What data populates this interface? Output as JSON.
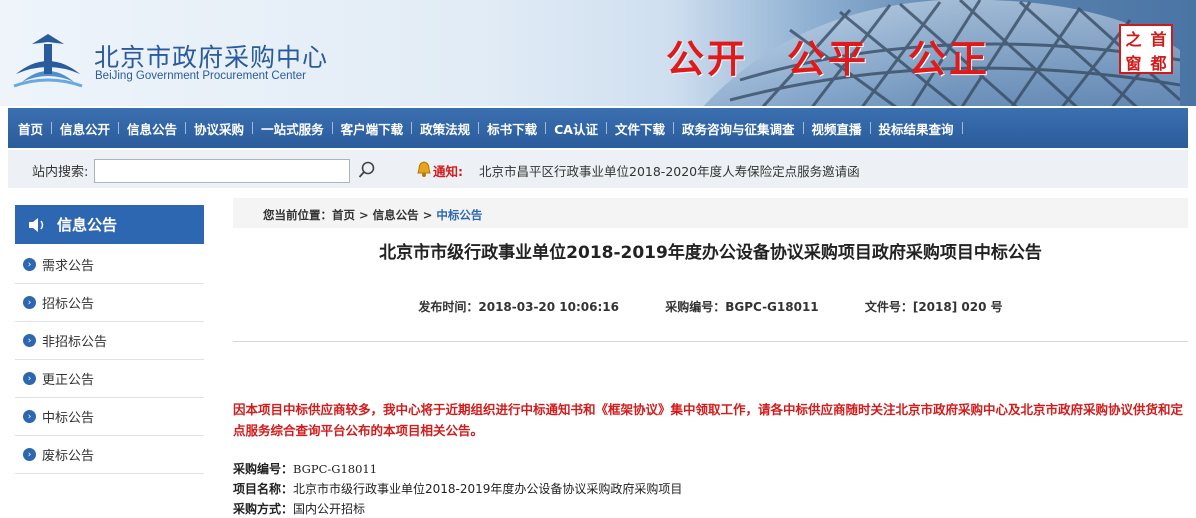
{
  "header": {
    "org_name_cn": "北京市政府采购中心",
    "org_name_en": "BeiJing Government Procurement Center",
    "slogans": [
      "公开",
      "公平",
      "公正"
    ],
    "seal_chars": [
      "之",
      "首",
      "窗",
      "都"
    ]
  },
  "nav": {
    "items": [
      "首页",
      "信息公开",
      "信息公告",
      "协议采购",
      "一站式服务",
      "客户端下载",
      "政策法规",
      "标书下载",
      "CA认证",
      "文件下载",
      "政务咨询与征集调查",
      "视频直播",
      "投标结果查询"
    ]
  },
  "search": {
    "label": "站内搜索:",
    "placeholder": "",
    "value": ""
  },
  "notice": {
    "tag": "通知:",
    "text": "北京市昌平区行政事业单位2018-2020年度人寿保险定点服务邀请函"
  },
  "sidebar": {
    "title": "信息公告",
    "items": [
      "需求公告",
      "招标公告",
      "非招标公告",
      "更正公告",
      "中标公告",
      "废标公告"
    ]
  },
  "breadcrumb": {
    "prefix": "您当前位置：",
    "home": "首页",
    "sep": ">",
    "section": "信息公告",
    "current": "中标公告"
  },
  "article": {
    "title": "北京市市级行政事业单位2018-2019年度办公设备协议采购项目政府采购项目中标公告",
    "publish_time": "发布时间：2018-03-20 10:06:16",
    "purchase_no": "采购编号：BGPC-G18011",
    "file_no": "文件号：[2018] 020 号",
    "notice": "因本项目中标供应商较多，我中心将于近期组织进行中标通知书和《框架协议》集中领取工作，请各中标供应商随时关注北京市政府采购中心及北京市政府采购协议供货和定点服务综合查询平台公布的本项目相关公告。",
    "fields": [
      {
        "label": "采购编号：",
        "value": "BGPC-G18011"
      },
      {
        "label": "项目名称：",
        "value": "北京市市级行政事业单位2018-2019年度办公设备协议采购政府采购项目"
      },
      {
        "label": "采购方式：",
        "value": "国内公开招标"
      }
    ]
  },
  "colors": {
    "nav_bg": "#2b5c9c",
    "accent_blue": "#2e67b1",
    "alert_red": "#d41b1b"
  }
}
